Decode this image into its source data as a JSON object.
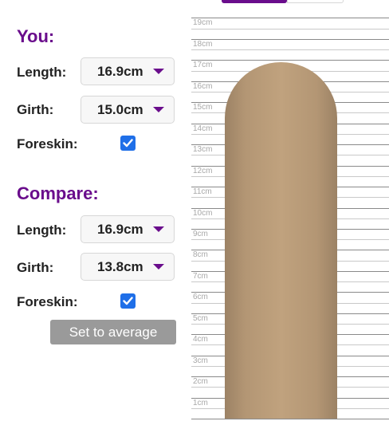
{
  "toggle": {
    "left_color": "#6a0d8c"
  },
  "you": {
    "title": "You:",
    "length_label": "Length:",
    "length_value": "16.9cm",
    "girth_label": "Girth:",
    "girth_value": "15.0cm",
    "foreskin_label": "Foreskin:",
    "foreskin_checked": true
  },
  "compare": {
    "title": "Compare:",
    "length_label": "Length:",
    "length_value": "16.9cm",
    "girth_label": "Girth:",
    "girth_value": "13.8cm",
    "foreskin_label": "Foreskin:",
    "foreskin_checked": true
  },
  "actions": {
    "set_average_label": "Set to average"
  },
  "ruler": {
    "unit": "cm",
    "ticks": [
      "1cm",
      "2cm",
      "3cm",
      "4cm",
      "5cm",
      "6cm",
      "7cm",
      "8cm",
      "9cm",
      "10cm",
      "11cm",
      "12cm",
      "13cm",
      "14cm",
      "15cm",
      "16cm",
      "17cm",
      "18cm",
      "19cm"
    ]
  },
  "visual": {
    "length_cm": 16.9,
    "skin_color": "#b89a77",
    "accent_color": "#6a0d8c",
    "checkbox_color": "#1f6fe8"
  }
}
